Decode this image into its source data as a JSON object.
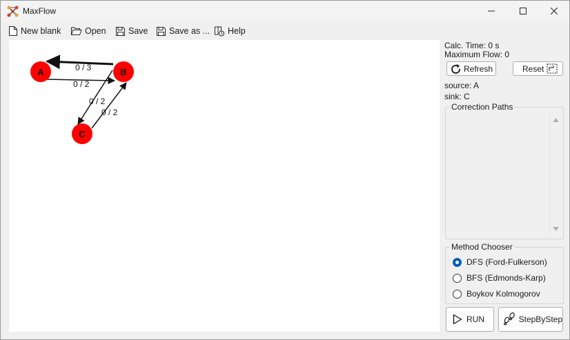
{
  "window": {
    "title": "MaxFlow",
    "controls": [
      "minimize",
      "maximize",
      "close"
    ]
  },
  "menu": {
    "new_blank": "New blank",
    "open": "Open",
    "save": "Save",
    "save_as": "Save as ...",
    "help": "Help"
  },
  "graph": {
    "nodes": [
      {
        "id": "A",
        "label": "A"
      },
      {
        "id": "B",
        "label": "B"
      },
      {
        "id": "C",
        "label": "C"
      }
    ],
    "edges": [
      {
        "from": "B",
        "to": "A",
        "label": "0 / 3"
      },
      {
        "from": "A",
        "to": "B",
        "label": "0 / 2"
      },
      {
        "from": "B",
        "to": "C",
        "label": "0 / 2"
      },
      {
        "from": "C",
        "to": "B",
        "label": "0 / 2"
      }
    ],
    "node_color": "#ff0000"
  },
  "stats": {
    "calc_time": "Calc. Time: 0 s",
    "max_flow": "Maximum Flow: 0"
  },
  "buttons": {
    "refresh": "Refresh",
    "reset": "Reset",
    "run": "RUN",
    "step": "StepByStep"
  },
  "source_sink": {
    "source": "source: A",
    "sink": "sink: C"
  },
  "correction_paths": {
    "legend": "Correction Paths"
  },
  "method_chooser": {
    "legend": "Method Chooser",
    "options": [
      {
        "label": "DFS (Ford-Fulkerson)",
        "checked": true
      },
      {
        "label": "BFS (Edmonds-Karp)",
        "checked": false
      },
      {
        "label": "Boykov Kolmogorov",
        "checked": false
      }
    ]
  },
  "colors": {
    "accent": "#005fb8",
    "node": "#ff0000"
  }
}
